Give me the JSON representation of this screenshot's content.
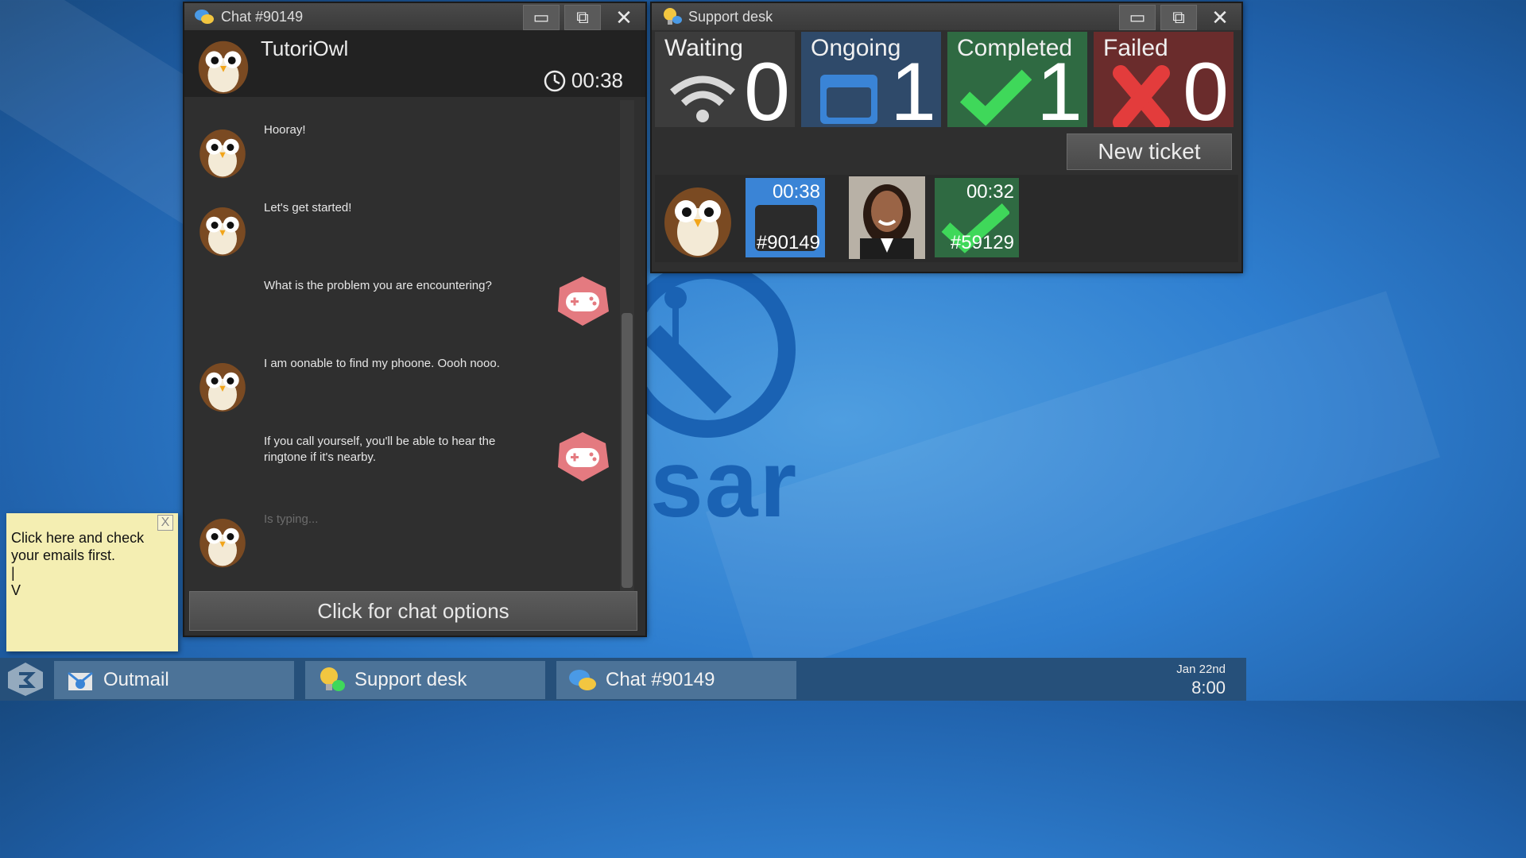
{
  "chat_window": {
    "title": "Chat #90149",
    "agent_name": "TutoriOwl",
    "timer": "00:38",
    "messages": [
      {
        "text": "Hooray!",
        "sender": "owl"
      },
      {
        "text": "Let's get started!",
        "sender": "owl"
      },
      {
        "text": "What is the problem you are encountering?",
        "sender": "agent"
      },
      {
        "text": "I am oonable to find my phoone. Oooh nooo.",
        "sender": "owl"
      },
      {
        "text": "If you call yourself, you'll be able to hear the ringtone if it's nearby.",
        "sender": "agent"
      },
      {
        "text": "Is typing...",
        "sender": "owl"
      }
    ],
    "options_label": "Click for chat options"
  },
  "support_desk": {
    "title": "Support desk",
    "stats": [
      {
        "label": "Waiting",
        "count": "0",
        "color": "#3c3c3c"
      },
      {
        "label": "Ongoing",
        "count": "1",
        "color": "#2f4a6a"
      },
      {
        "label": "Completed",
        "count": "1",
        "color": "#2f6a42"
      },
      {
        "label": "Failed",
        "count": "0",
        "color": "#6a2c2c"
      }
    ],
    "new_ticket_label": "New ticket",
    "tickets": [
      {
        "time": "00:38",
        "id": "#90149",
        "status": "ongoing",
        "color": "#3a84d6"
      },
      {
        "time": "00:32",
        "id": "#59129",
        "status": "completed",
        "color": "#2f6a42"
      }
    ]
  },
  "sticky_note": {
    "text": "Click here and check your emails first.\n|\nV",
    "close_label": "X"
  },
  "taskbar": {
    "items": [
      {
        "label": "Outmail"
      },
      {
        "label": "Support desk"
      },
      {
        "label": "Chat #90149"
      }
    ],
    "date": "Jan 22nd",
    "time": "8:00"
  },
  "wallpaper": {
    "text": "sar"
  }
}
